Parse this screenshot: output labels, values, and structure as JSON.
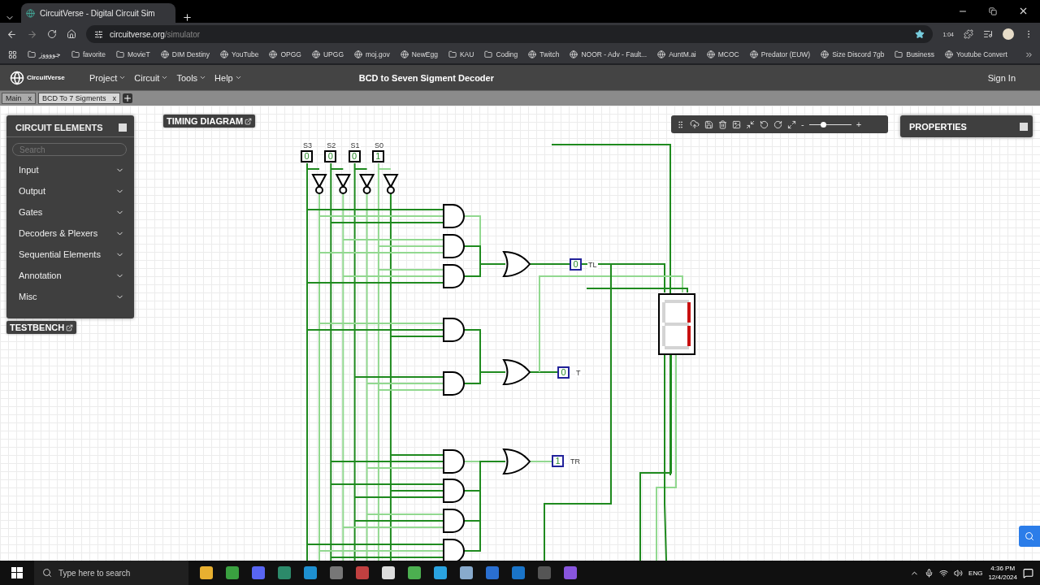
{
  "browser": {
    "tab_title": "CircuitVerse - Digital Circuit Sim",
    "url_host": "circuitverse.org",
    "url_path": "/simulator",
    "extension_badge": "1:04",
    "bookmarks": [
      {
        "label": "جووووز",
        "kind": "folder"
      },
      {
        "label": "favorite",
        "kind": "folder"
      },
      {
        "label": "MovieT",
        "kind": "folder"
      },
      {
        "label": "DIM Destiny",
        "kind": "site"
      },
      {
        "label": "YouTube",
        "kind": "site"
      },
      {
        "label": "OPGG",
        "kind": "site"
      },
      {
        "label": "UPGG",
        "kind": "site"
      },
      {
        "label": "moj.gov",
        "kind": "site"
      },
      {
        "label": "NewEgg",
        "kind": "site"
      },
      {
        "label": "KAU",
        "kind": "folder"
      },
      {
        "label": "Coding",
        "kind": "folder"
      },
      {
        "label": "Twitch",
        "kind": "site"
      },
      {
        "label": "NOOR - Adv - Fault...",
        "kind": "site"
      },
      {
        "label": "AuntM.ai",
        "kind": "site"
      },
      {
        "label": "MCOC",
        "kind": "site"
      },
      {
        "label": "Predator (EUW)",
        "kind": "site"
      },
      {
        "label": "Size Discord 7gb",
        "kind": "site"
      },
      {
        "label": "Business",
        "kind": "folder"
      },
      {
        "label": "Youtube Convert",
        "kind": "site"
      }
    ]
  },
  "app": {
    "brand": "CircuitVerse",
    "menus": [
      "Project",
      "Circuit",
      "Tools",
      "Help"
    ],
    "title": "BCD to Seven Sigment Decoder",
    "sign_in": "Sign In",
    "circuit_tabs": [
      {
        "label": "Main",
        "close": "x",
        "selected": false
      },
      {
        "label": "BCD To 7 Sigments",
        "close": "x",
        "selected": true
      }
    ]
  },
  "elements_panel": {
    "title": "CIRCUIT ELEMENTS",
    "search": {
      "placeholder": "Search"
    },
    "items": [
      "Input",
      "Output",
      "Gates",
      "Decoders & Plexers",
      "Sequential Elements",
      "Annotation",
      "Misc"
    ]
  },
  "timing_diagram": "TIMING DIAGRAM",
  "testbench": "TESTBENCH",
  "properties": "PROPERTIES",
  "zoom": {
    "minus": "-",
    "plus": "+",
    "level": 0.33
  },
  "circuit": {
    "inputs": [
      {
        "label": "S3",
        "value": "0"
      },
      {
        "label": "S2",
        "value": "0"
      },
      {
        "label": "S1",
        "value": "0"
      },
      {
        "label": "S0",
        "value": "1"
      }
    ],
    "outputs": [
      {
        "label": "TL",
        "value": "0"
      },
      {
        "label": "T",
        "value": "0"
      },
      {
        "label": "TR",
        "value": "1"
      }
    ],
    "segments": [
      {
        "on": false
      },
      {
        "on": true
      },
      {
        "on": true
      },
      {
        "on": false
      },
      {
        "on": false
      },
      {
        "on": false
      },
      {
        "on": false
      }
    ]
  },
  "taskbar": {
    "search_placeholder": "Type here to search",
    "language": "ENG",
    "time": "4:36 PM",
    "date": "12/4/2024"
  }
}
